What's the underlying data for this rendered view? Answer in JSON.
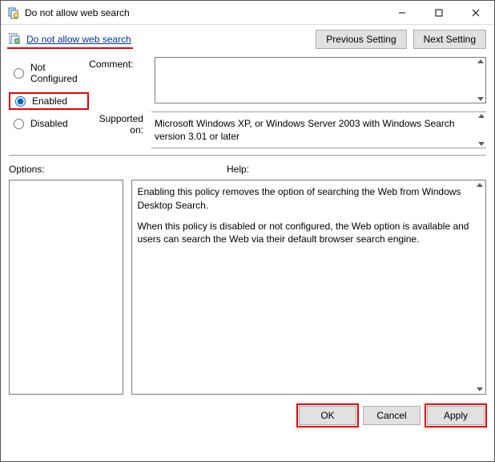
{
  "window": {
    "title": "Do not allow web search"
  },
  "header": {
    "link_text": "Do not allow web search",
    "prev_label": "Previous Setting",
    "next_label": "Next Setting"
  },
  "radios": {
    "not_configured": "Not Configured",
    "enabled": "Enabled",
    "disabled": "Disabled"
  },
  "labels": {
    "comment": "Comment:",
    "supported_on": "Supported on:",
    "options": "Options:",
    "help": "Help:"
  },
  "supported_text": "Microsoft Windows XP, or Windows Server 2003 with Windows Search version 3.01 or later",
  "help": {
    "p1": "Enabling this policy removes the option of searching the Web from Windows Desktop Search.",
    "p2": "When this policy is disabled or not configured, the Web option is available and users can search the Web via their default browser search engine."
  },
  "footer": {
    "ok": "OK",
    "cancel": "Cancel",
    "apply": "Apply"
  }
}
